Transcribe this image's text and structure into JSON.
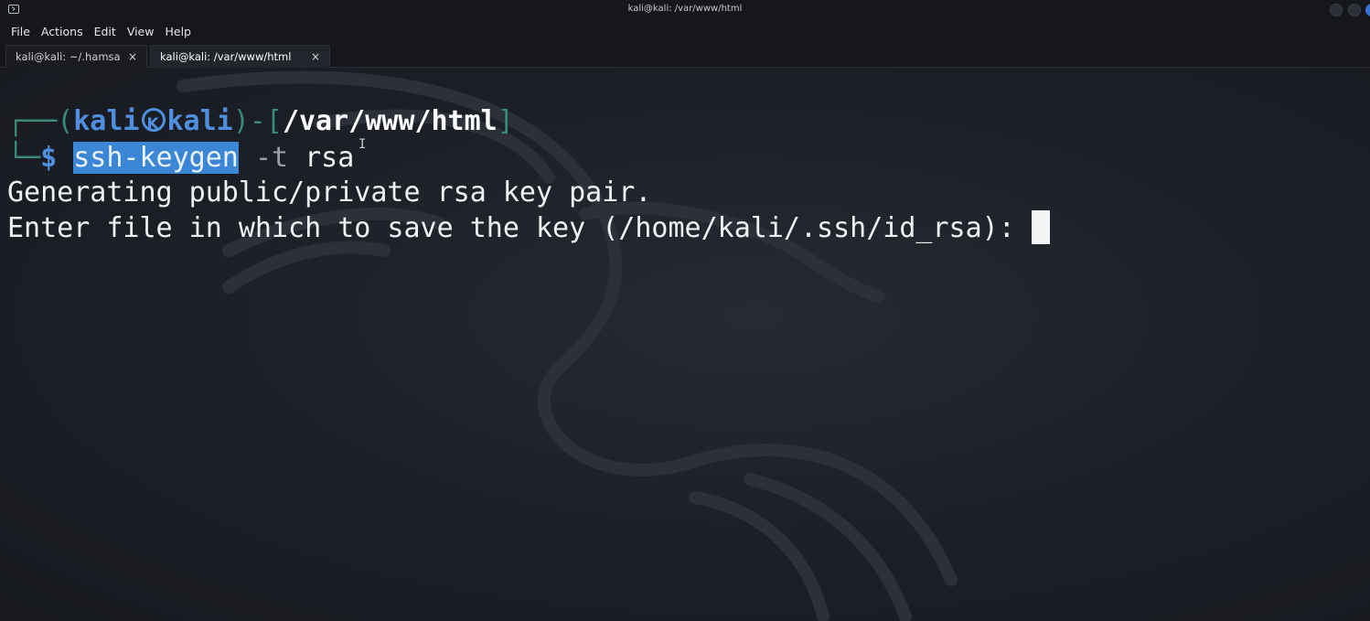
{
  "window": {
    "title": "kali@kali: /var/www/html"
  },
  "menu": {
    "items": [
      "File",
      "Actions",
      "Edit",
      "View",
      "Help"
    ]
  },
  "tabs": [
    {
      "label": "kali@kali: ~/.hamsa",
      "close": "×",
      "active": false
    },
    {
      "label": "kali@kali: /var/www/html",
      "close": "×",
      "active": true
    }
  ],
  "terminal": {
    "prompt": {
      "corner_top": "┌──",
      "open_paren": "(",
      "user": "kali",
      "host": "kali",
      "close_bracket_open": ")-[",
      "path": "/var/www/html",
      "close_bracket": "]",
      "corner_bottom": "└─",
      "dollar": "$"
    },
    "command": {
      "name": "ssh-keygen",
      "args_flag": "-t",
      "args_value": "rsa"
    },
    "output": [
      "Generating public/private rsa key pair.",
      "Enter file in which to save the key (/home/kali/.ssh/id_rsa): "
    ]
  },
  "colors": {
    "prompt_blue": "#4f8fe0",
    "prompt_frame": "#3a8a7a",
    "selection": "#3b87d6",
    "background": "#1b1e25"
  },
  "icons": {
    "app": "terminal-icon",
    "prompt_separator": "kali-logo-icon"
  }
}
